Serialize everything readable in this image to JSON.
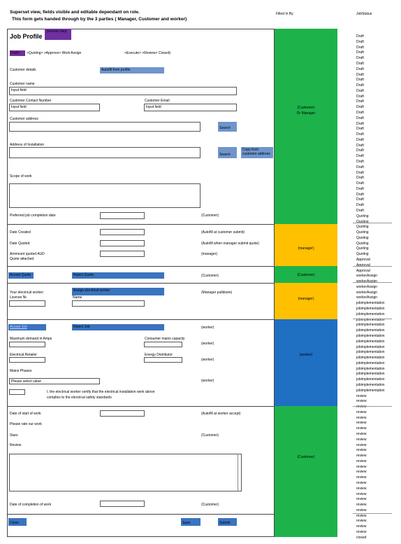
{
  "header": {
    "line1": "Superset view, fields visible and editable dependant on role.",
    "line2": "This form gets handed through by the 3 parties ( Manager, Customer and worker)",
    "filled_in_by": "Filled In By",
    "job_status": "JobStatus"
  },
  "form": {
    "title": "Job Profile",
    "process_step": "process step",
    "flow": {
      "draft": "Draft>",
      "rest": ">Quoting> >Approve>    Work Assign",
      "rest2": ">Execute> >Review> Closed)"
    },
    "customer_details": "Customer details",
    "autofill_profile": "Autofill from profile",
    "customer_name": "Customer name",
    "input_field": "Input field",
    "contact_number": "Customer Contact Number",
    "customer_email": "Customer Email",
    "customer_address": "Customer address",
    "search": "Search",
    "installation_address": "Address of Installation",
    "copy_from": "Copy from customer address",
    "scope": "Scope of work",
    "preferred_date": "Preferred job completion date",
    "date_created": "Date  Created",
    "date_quoted": "Date  Quoted",
    "amount_quoted": "Ammount quoted     AUD",
    "quote_attached": "Quote attached",
    "accept_quote": "Accept Quote",
    "reject_quote": "Reject Quote",
    "your_worker": "Your electrical worker:",
    "license": "License Nr.",
    "assign_worker": "Assign electrical worker",
    "name": "Name",
    "accept_job": "Accept Job",
    "reject_job": "Reject Job",
    "max_demand": "Maximum demand in Amps",
    "consumer_capacity": "Consumer mains capacity",
    "retailer": "Electrical Retailer",
    "distributor": "Energy Distributor",
    "mains_phases": "Mains Phases",
    "please_select": "Please select value",
    "certify1": "I, the electrical worker certify that the electrical installation work above",
    "certify2": "complies to the electrical safety standards",
    "start_date": "Date of start of work",
    "rate": "Please rate our work",
    "stars": "Stars",
    "review": "Review",
    "completion_date": "Date of completion of work",
    "close": "Close",
    "save": "Save",
    "submit": "Submit"
  },
  "notes": {
    "customer": "(Customer)",
    "autofill_submit": "(Autofill at customer submit)",
    "autofill_quote": "(Autofill when manager submit quote)",
    "manager": "(manager)",
    "manager_pulldown": "(Manager pulldown)",
    "worker": "(worker)",
    "autofill_accept": "(Autofill at worker accept)"
  },
  "filled_by": {
    "band1a": "(Customer)",
    "band1b": "Or Manager",
    "band2": "(manager)",
    "band3": "(Customer)",
    "band4": "(manager)",
    "band5": "(worker)",
    "band6": "(Customer)"
  },
  "colors": {
    "green": "#1db34a",
    "yellow": "#ffc000",
    "blue": "#1f6fc3",
    "button": "#3a73bf",
    "purple": "#7030a0"
  },
  "status_column": [
    "Draft",
    "Draft",
    "Draft",
    "Draft",
    "Draft",
    "Draft",
    "Draft",
    "Draft",
    "Draft",
    "Draft",
    "Draft",
    "Draft",
    "Draft",
    "Draft",
    "Draft",
    "Draft",
    "Draft",
    "Draft",
    "Draft",
    "Draft",
    "Draft",
    "Draft",
    "Draft",
    "Draft",
    "Draft",
    "Draft",
    "Draft",
    "Draft",
    "Draft",
    "Draft",
    "Draft",
    "Draft",
    "Draft",
    "Quoting",
    "Quoting",
    "Quoting",
    "Quoting",
    "Quoting",
    "Quoting",
    "Quoting",
    "Quoting",
    "Approval",
    "Approval",
    "Approval",
    "workerAssign",
    "workerAssign",
    "workerAssign",
    "workerAssign",
    "workerAssign",
    "jobimplementation",
    "jobimplementation",
    "jobimplementation",
    "jobimplementation",
    "jobimplementation",
    "jobimplementation",
    "jobimplementation",
    "jobimplementation",
    "jobimplementation",
    "jobimplementation",
    "jobimplementation",
    "jobimplementation",
    "jobimplementation",
    "jobimplementation",
    "jobimplementation",
    "jobimplementation",
    "jobimplementation",
    "review",
    "review",
    "review",
    "review",
    "review",
    "review",
    "review",
    "review",
    "review",
    "review",
    "review",
    "review",
    "review",
    "review",
    "review",
    "review",
    "review",
    "review",
    "review",
    "review",
    "review",
    "review",
    "review",
    "review",
    "review",
    "review",
    "closed"
  ]
}
